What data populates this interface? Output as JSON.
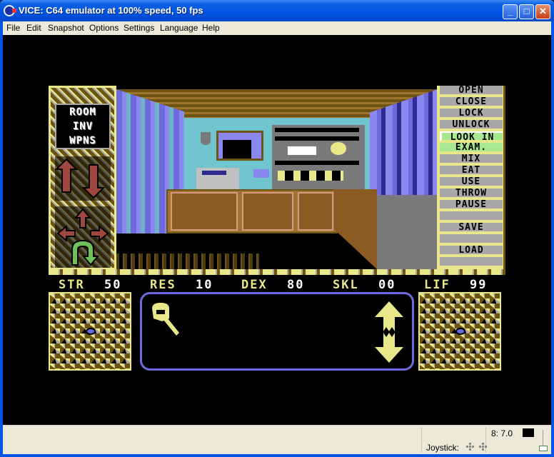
{
  "window": {
    "title": "VICE: C64 emulator at 100% speed, 50 fps",
    "controls": {
      "minimize": "_",
      "maximize": "□",
      "close": "✕"
    }
  },
  "menubar": {
    "items": [
      {
        "label": "File",
        "accel": "F"
      },
      {
        "label": "Edit",
        "accel": "E"
      },
      {
        "label": "Snapshot",
        "accel": ""
      },
      {
        "label": "Options",
        "accel": "O"
      },
      {
        "label": "Settings",
        "accel": "t"
      },
      {
        "label": "Language",
        "accel": "L"
      },
      {
        "label": "Help",
        "accel": "H"
      }
    ]
  },
  "game": {
    "nav_panel": {
      "modes": [
        "ROOM",
        "INV",
        "WPNS"
      ],
      "arrows": [
        "up-arrow",
        "down-arrow"
      ],
      "directions": [
        "forward",
        "left",
        "right",
        "turn-back"
      ]
    },
    "commands": [
      {
        "label": "OPEN",
        "state": "normal"
      },
      {
        "label": "CLOSE",
        "state": "normal"
      },
      {
        "label": "LOCK",
        "state": "normal"
      },
      {
        "label": "UNLOCK",
        "state": "normal"
      },
      {
        "label": "LOOK IN",
        "state": "highlight-selected"
      },
      {
        "label": "EXAM.",
        "state": "highlight"
      },
      {
        "label": "MIX",
        "state": "normal"
      },
      {
        "label": "EAT",
        "state": "normal"
      },
      {
        "label": "USE",
        "state": "normal"
      },
      {
        "label": "THROW",
        "state": "normal"
      },
      {
        "label": "PAUSE",
        "state": "normal"
      },
      {
        "label": "",
        "state": "normal"
      },
      {
        "label": "SAVE",
        "state": "normal"
      },
      {
        "label": "",
        "state": "normal"
      },
      {
        "label": "LOAD",
        "state": "normal"
      },
      {
        "label": "",
        "state": "normal"
      }
    ],
    "stats": [
      {
        "label": "STR",
        "value": "50"
      },
      {
        "label": "RES",
        "value": "10"
      },
      {
        "label": "DEX",
        "value": "80"
      },
      {
        "label": "SKL",
        "value": "00"
      },
      {
        "label": "LIF",
        "value": "99"
      }
    ],
    "inventory": {
      "item_icon": "key-icon",
      "scroll_up": "scroll-up-arrow",
      "scroll_down": "scroll-down-arrow"
    },
    "colors": {
      "yellow": "#e8e88a",
      "brown": "#6d5412",
      "grey": "#a8a8a8",
      "green": "#a8e890",
      "purple": "#6d6add",
      "cyan": "#70c4ce",
      "red": "#a0473f"
    }
  },
  "statusbar": {
    "drive_status": "8: 7.0",
    "joystick_label": "Joystick:"
  }
}
